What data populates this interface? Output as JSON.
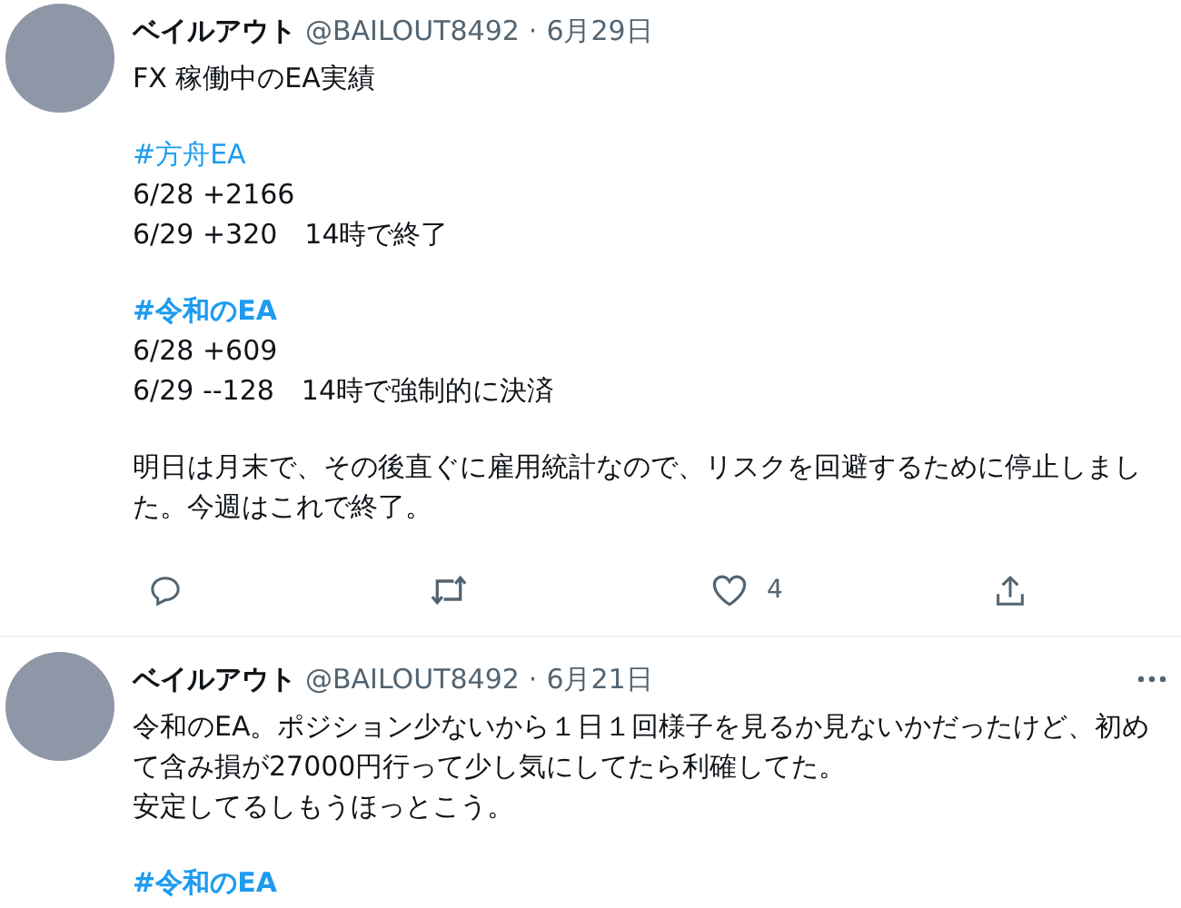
{
  "tweets": [
    {
      "name": "ベイルアウト",
      "handle": "@BAILOUT8492",
      "separator": "·",
      "date": "6月29日",
      "paragraphs": [
        [
          {
            "kind": "text",
            "text": "FX 稼働中のEA実績",
            "bold": false
          }
        ],
        [
          {
            "kind": "hashtag",
            "text": "#方舟EA",
            "bold": false
          },
          {
            "kind": "text",
            "text": "6/28 +2166",
            "bold": false
          },
          {
            "kind": "text",
            "text": "6/29 +320　14時で終了",
            "bold": false
          }
        ],
        [
          {
            "kind": "hashtag",
            "text": "#令和のEA",
            "bold": true
          },
          {
            "kind": "text",
            "text": "6/28 +609",
            "bold": false
          },
          {
            "kind": "text",
            "text": "6/29 --128　14時で強制的に決済",
            "bold": false
          }
        ],
        [
          {
            "kind": "text",
            "text": "明日は月末で、その後直ぐに雇用統計なので、リスクを回避するために停止しました。今週はこれで終了。",
            "bold": false
          }
        ]
      ],
      "actions": {
        "like_count": "4"
      }
    },
    {
      "name": "ベイルアウト",
      "handle": "@BAILOUT8492",
      "separator": "·",
      "date": "6月21日",
      "paragraphs": [
        [
          {
            "kind": "text",
            "text": "令和のEA。ポジション少ないから１日１回様子を見るか見ないかだったけど、初めて含み損が27000円行って少し気にしてたら利確してた。",
            "bold": false
          },
          {
            "kind": "text",
            "text": "安定してるしもうほっとこう。",
            "bold": false
          }
        ],
        [
          {
            "kind": "hashtag",
            "text": "#令和のEA",
            "bold": true
          }
        ]
      ]
    }
  ]
}
